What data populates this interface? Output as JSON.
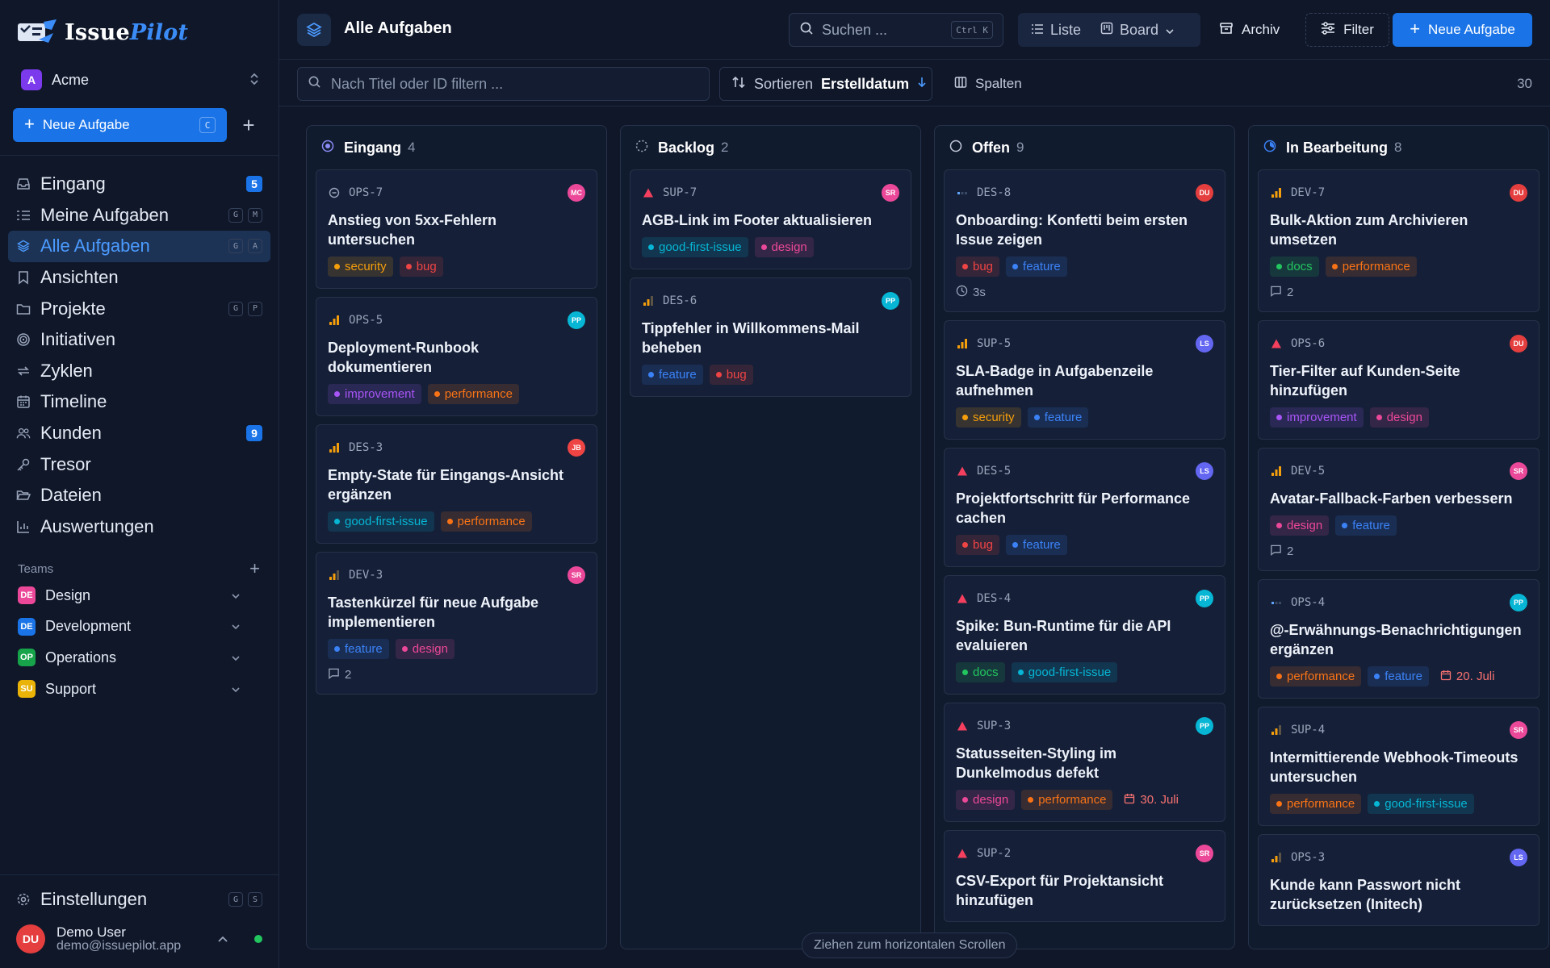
{
  "app": {
    "name_part1": "Issue",
    "name_part2": "Pilot"
  },
  "workspace": {
    "initial": "A",
    "name": "Acme"
  },
  "sidebar": {
    "new_issue_label": "Neue Aufgabe",
    "new_issue_key": "C",
    "nav": [
      {
        "id": "inbox",
        "label": "Eingang",
        "icon": "inbox-icon",
        "badge": "5"
      },
      {
        "id": "my-issues",
        "label": "Meine Aufgaben",
        "icon": "list-icon",
        "keys": [
          "G",
          "M"
        ]
      },
      {
        "id": "all-issues",
        "label": "Alle Aufgaben",
        "icon": "layers-icon",
        "keys": [
          "G",
          "A"
        ],
        "active": true
      },
      {
        "id": "views",
        "label": "Ansichten",
        "icon": "bookmark-icon"
      },
      {
        "id": "projects",
        "label": "Projekte",
        "icon": "folder-icon",
        "keys": [
          "G",
          "P"
        ]
      },
      {
        "id": "initiatives",
        "label": "Initiativen",
        "icon": "target-icon"
      },
      {
        "id": "cycles",
        "label": "Zyklen",
        "icon": "repeat-icon"
      },
      {
        "id": "timeline",
        "label": "Timeline",
        "icon": "calendar-icon"
      },
      {
        "id": "customers",
        "label": "Kunden",
        "icon": "users-icon",
        "badge": "9"
      },
      {
        "id": "vault",
        "label": "Tresor",
        "icon": "key-icon"
      },
      {
        "id": "files",
        "label": "Dateien",
        "icon": "folder-open-icon"
      },
      {
        "id": "reports",
        "label": "Auswertungen",
        "icon": "bar-chart-icon"
      }
    ],
    "teams_label": "Teams",
    "teams": [
      {
        "initials": "DE",
        "name": "Design",
        "color": "#ec4899"
      },
      {
        "initials": "DE",
        "name": "Development",
        "color": "#1a74e8"
      },
      {
        "initials": "OP",
        "name": "Operations",
        "color": "#16a34a"
      },
      {
        "initials": "SU",
        "name": "Support",
        "color": "#eab308"
      }
    ],
    "settings": {
      "label": "Einstellungen",
      "keys": [
        "G",
        "S"
      ]
    },
    "user": {
      "initials": "DU",
      "name": "Demo User",
      "email": "demo@issuepilot.app"
    }
  },
  "header": {
    "title": "Alle Aufgaben",
    "search_placeholder": "Suchen ...",
    "search_shortcut": "Ctrl K",
    "view_list": "Liste",
    "view_board": "Board",
    "archive": "Archiv",
    "filter": "Filter",
    "new_task": "Neue Aufgabe"
  },
  "filterbar": {
    "title_filter_placeholder": "Nach Titel oder ID filtern ...",
    "sort_label": "Sortieren",
    "sort_value": "Erstelldatum",
    "columns": "Spalten",
    "total": "30"
  },
  "colors": {
    "accent": "#1a74e8",
    "tags": {
      "security": "#f59e0b",
      "bug": "#ef4444",
      "improvement": "#a855f7",
      "performance": "#f97316",
      "good-first-issue": "#06b6d4",
      "feature": "#3b82f6",
      "design": "#ec4899",
      "docs": "#22c55e"
    },
    "avatars": {
      "MC": "#ec4899",
      "PP": "#06b6d4",
      "JB": "#ef4444",
      "SR": "#ec4899",
      "DU": "#e53e3e",
      "LS": "#6366f1"
    }
  },
  "columns": [
    {
      "title": "Eingang",
      "count": "4",
      "status_icon": "inbox-status-icon",
      "cards": [
        {
          "id": "OPS-7",
          "priority": "none",
          "avatar": "MC",
          "title": "Anstieg von 5xx-Fehlern untersuchen",
          "tags": [
            "security",
            "bug"
          ]
        },
        {
          "id": "OPS-5",
          "priority": "high",
          "avatar": "PP",
          "title": "Deployment-Runbook dokumentieren",
          "tags": [
            "improvement",
            "performance"
          ]
        },
        {
          "id": "DES-3",
          "priority": "high",
          "avatar": "JB",
          "title": "Empty-State für Eingangs-Ansicht ergänzen",
          "tags": [
            "good-first-issue",
            "performance"
          ]
        },
        {
          "id": "DEV-3",
          "priority": "medium",
          "avatar": "SR",
          "title": "Tastenkürzel für neue Aufgabe implementieren",
          "tags": [
            "feature",
            "design"
          ],
          "comments": "2"
        }
      ]
    },
    {
      "title": "Backlog",
      "count": "2",
      "status_icon": "backlog-status-icon",
      "cards": [
        {
          "id": "SUP-7",
          "priority": "urgent",
          "avatar": "SR",
          "title": "AGB-Link im Footer aktualisieren",
          "tags": [
            "good-first-issue",
            "design"
          ]
        },
        {
          "id": "DES-6",
          "priority": "medium",
          "avatar": "PP",
          "title": "Tippfehler in Willkommens-Mail beheben",
          "tags": [
            "feature",
            "bug"
          ]
        }
      ]
    },
    {
      "title": "Offen",
      "count": "9",
      "status_icon": "open-status-icon",
      "cards": [
        {
          "id": "DES-8",
          "priority": "low",
          "avatar": "DU",
          "title": "Onboarding: Konfetti beim ersten Issue zeigen",
          "tags": [
            "bug",
            "feature"
          ],
          "time": "3s"
        },
        {
          "id": "SUP-5",
          "priority": "high",
          "avatar": "LS",
          "title": "SLA-Badge in Aufgabenzeile aufnehmen",
          "tags": [
            "security",
            "feature"
          ]
        },
        {
          "id": "DES-5",
          "priority": "urgent",
          "avatar": "LS",
          "title": "Projektfortschritt für Performance cachen",
          "tags": [
            "bug",
            "feature"
          ]
        },
        {
          "id": "DES-4",
          "priority": "urgent",
          "avatar": "PP",
          "title": "Spike: Bun-Runtime für die API evaluieren",
          "tags": [
            "docs",
            "good-first-issue"
          ]
        },
        {
          "id": "SUP-3",
          "priority": "urgent",
          "avatar": "PP",
          "title": "Statusseiten-Styling im Dunkelmodus defekt",
          "tags": [
            "design",
            "performance"
          ],
          "due": "30. Juli"
        },
        {
          "id": "SUP-2",
          "priority": "urgent",
          "avatar": "SR",
          "title": "CSV-Export für Projektansicht hinzufügen",
          "tags": []
        }
      ]
    },
    {
      "title": "In Bearbeitung",
      "count": "8",
      "status_icon": "in-progress-status-icon",
      "cards": [
        {
          "id": "DEV-7",
          "priority": "high",
          "avatar": "DU",
          "title": "Bulk-Aktion zum Archivieren umsetzen",
          "tags": [
            "docs",
            "performance"
          ],
          "comments": "2"
        },
        {
          "id": "OPS-6",
          "priority": "urgent",
          "avatar": "DU",
          "title": "Tier-Filter auf Kunden-Seite hinzufügen",
          "tags": [
            "improvement",
            "design"
          ]
        },
        {
          "id": "DEV-5",
          "priority": "high",
          "avatar": "SR",
          "title": "Avatar-Fallback-Farben verbessern",
          "tags": [
            "design",
            "feature"
          ],
          "comments": "2"
        },
        {
          "id": "OPS-4",
          "priority": "low",
          "avatar": "PP",
          "title": "@-Erwähnungs-Benachrichtigungen ergänzen",
          "tags": [
            "performance",
            "feature"
          ],
          "due": "20. Juli"
        },
        {
          "id": "SUP-4",
          "priority": "medium",
          "avatar": "SR",
          "title": "Intermittierende Webhook-Timeouts untersuchen",
          "tags": [
            "performance",
            "good-first-issue"
          ]
        },
        {
          "id": "OPS-3",
          "priority": "medium",
          "avatar": "LS",
          "title": "Kunde kann Passwort nicht zurücksetzen (Initech)",
          "tags": []
        }
      ]
    }
  ],
  "scroll_hint": "Ziehen zum horizontalen Scrollen"
}
